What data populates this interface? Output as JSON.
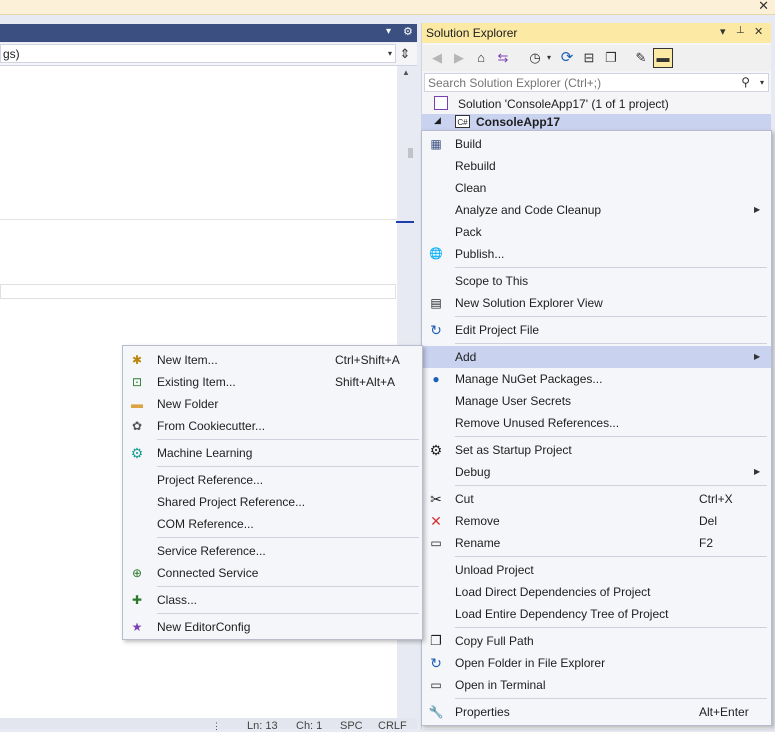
{
  "infobar": {
    "close_glyph": "✕"
  },
  "editor": {
    "nav_text": "gs)",
    "controls": {
      "dropdown": "▾",
      "gear": "⚙",
      "split": "⇕"
    }
  },
  "statusbar": {
    "line": "Ln: 13",
    "col": "Ch: 1",
    "spacing": "SPC",
    "eol": "CRLF"
  },
  "solution_explorer": {
    "title": "Solution Explorer",
    "title_controls": {
      "dropdown": "▾",
      "pin": "📌",
      "close": "✕"
    },
    "search_placeholder": "Search Solution Explorer (Ctrl+;)",
    "solution_label": "Solution 'ConsoleApp17' (1 of 1 project)",
    "project_label": "ConsoleApp17",
    "project_badge": "C#",
    "expand_glyph": "◢"
  },
  "context_menu": {
    "items": [
      {
        "label": "Build",
        "icon": "build-icon",
        "glyph": "▦"
      },
      {
        "label": "Rebuild"
      },
      {
        "label": "Clean"
      },
      {
        "label": "Analyze and Code Cleanup",
        "submenu": true
      },
      {
        "label": "Pack"
      },
      {
        "label": "Publish...",
        "icon": "globe-icon",
        "glyph": "🌐"
      },
      {
        "label": "Scope to This"
      },
      {
        "label": "New Solution Explorer View",
        "icon": "new-view-icon",
        "glyph": "▤"
      },
      {
        "label": "Edit Project File",
        "icon": "edit-project-icon",
        "glyph": "↻"
      },
      {
        "label": "Add",
        "submenu": true
      },
      {
        "label": "Manage NuGet Packages...",
        "icon": "nuget-icon",
        "glyph": "●"
      },
      {
        "label": "Manage User Secrets"
      },
      {
        "label": "Remove Unused References..."
      },
      {
        "label": "Set as Startup Project",
        "icon": "gear-icon",
        "glyph": "⚙"
      },
      {
        "label": "Debug",
        "submenu": true
      },
      {
        "label": "Cut",
        "icon": "scissors-icon",
        "glyph": "✂",
        "shortcut": "Ctrl+X"
      },
      {
        "label": "Remove",
        "icon": "remove-icon",
        "glyph": "✕",
        "shortcut": "Del"
      },
      {
        "label": "Rename",
        "icon": "rename-icon",
        "glyph": "▭",
        "shortcut": "F2"
      },
      {
        "label": "Unload Project"
      },
      {
        "label": "Load Direct Dependencies of Project"
      },
      {
        "label": "Load Entire Dependency Tree of Project"
      },
      {
        "label": "Copy Full Path",
        "icon": "copy-icon",
        "glyph": "❐"
      },
      {
        "label": "Open Folder in File Explorer",
        "icon": "folder-open-icon",
        "glyph": "↻"
      },
      {
        "label": "Open in Terminal",
        "icon": "terminal-icon",
        "glyph": "▭"
      },
      {
        "label": "Properties",
        "icon": "wrench-icon",
        "glyph": "🔧",
        "shortcut": "Alt+Enter"
      }
    ],
    "submenu_glyph": "▶"
  },
  "add_menu": {
    "items": [
      {
        "label": "New Item...",
        "icon": "new-item-icon",
        "glyph": "✱",
        "shortcut": "Ctrl+Shift+A"
      },
      {
        "label": "Existing Item...",
        "icon": "existing-item-icon",
        "glyph": "⊡",
        "shortcut": "Shift+Alt+A"
      },
      {
        "label": "New Folder",
        "icon": "folder-icon",
        "glyph": "▬"
      },
      {
        "label": "From Cookiecutter...",
        "icon": "cookiecutter-icon",
        "glyph": "✿"
      },
      {
        "label": "Machine Learning",
        "icon": "machine-learning-icon",
        "glyph": "⚙"
      },
      {
        "label": "Project Reference..."
      },
      {
        "label": "Shared Project Reference..."
      },
      {
        "label": "COM Reference..."
      },
      {
        "label": "Service Reference..."
      },
      {
        "label": "Connected Service",
        "icon": "connected-service-icon",
        "glyph": "⊕"
      },
      {
        "label": "Class...",
        "icon": "class-icon",
        "glyph": "✚"
      },
      {
        "label": "New EditorConfig",
        "icon": "editorconfig-icon",
        "glyph": "★"
      }
    ]
  },
  "colors": {
    "accent_blue": "#3b4f81",
    "highlight": "#c9d3f0",
    "se_title": "#fce9a3",
    "remove_red": "#d13438",
    "icon_blue": "#1c5fb8",
    "icon_purple": "#7b3fb5",
    "icon_teal": "#1a9e8f"
  }
}
